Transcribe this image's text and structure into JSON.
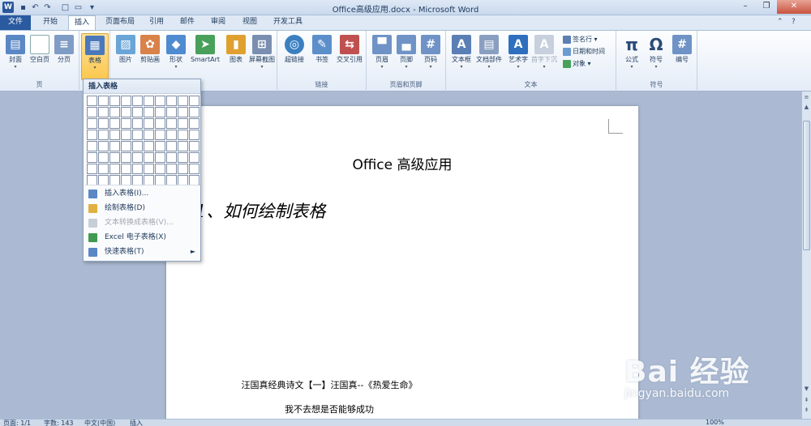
{
  "window": {
    "title": "Office高级应用.docx - Microsoft Word",
    "logo": "W"
  },
  "qat": [
    {
      "icon": "save-icon",
      "glyph": "▪"
    },
    {
      "icon": "undo-icon",
      "glyph": "↶"
    },
    {
      "icon": "redo-icon",
      "glyph": "↷"
    },
    {
      "icon": "new-icon",
      "glyph": "□"
    },
    {
      "icon": "open-icon",
      "glyph": "▭"
    },
    {
      "icon": "customize-icon",
      "glyph": "▾"
    }
  ],
  "tabs": [
    "文件",
    "开始",
    "插入",
    "页面布局",
    "引用",
    "邮件",
    "审阅",
    "视图",
    "开发工具"
  ],
  "active_tab": "插入",
  "ribbon": {
    "pages": {
      "label": "页",
      "buttons": [
        "封面",
        "空白页",
        "分页"
      ]
    },
    "tables": {
      "buttons": [
        "表格"
      ]
    },
    "illustrations": {
      "buttons": [
        "图片",
        "剪贴画",
        "形状",
        "SmartArt",
        "图表",
        "屏幕截图"
      ]
    },
    "links": {
      "label": "链接",
      "buttons": [
        "超链接",
        "书签",
        "交叉引用"
      ]
    },
    "header_footer": {
      "label": "页眉和页脚",
      "buttons": [
        "页眉",
        "页脚",
        "页码"
      ]
    },
    "text": {
      "label": "文本",
      "buttons": [
        "文本框",
        "文档部件",
        "艺术字",
        "首字下沉"
      ],
      "small": [
        "签名行",
        "日期和时间",
        "对象"
      ]
    },
    "symbols": {
      "label": "符号",
      "buttons": [
        "公式",
        "符号",
        "编号"
      ]
    }
  },
  "dropdown": {
    "header": "插入表格",
    "grid_rows": 8,
    "grid_cols": 10,
    "items": [
      {
        "label": "插入表格(I)...",
        "disabled": false
      },
      {
        "label": "绘制表格(D)",
        "disabled": false
      },
      {
        "label": "文本转换成表格(V)...",
        "disabled": true
      },
      {
        "label": "Excel 电子表格(X)",
        "disabled": false
      },
      {
        "label": "快速表格(T)",
        "disabled": false,
        "submenu": true
      }
    ]
  },
  "document": {
    "title": "Office 高级应用",
    "heading": "1、如何绘制表格",
    "lines": [
      "汪国真经典诗文【一】汪国真--《热爱生命》",
      "我不去想是否能够成功"
    ]
  },
  "status": {
    "page": "页面: 1/1",
    "words": "字数: 143",
    "lang": "中文(中国)",
    "mode": "插入",
    "zoom": "100%"
  },
  "watermark": {
    "main": "Bai 经验",
    "url": "jingyan.baidu.com"
  },
  "colors": {
    "accent": "#2a5aa0",
    "selected_button": "#fbc84f"
  }
}
